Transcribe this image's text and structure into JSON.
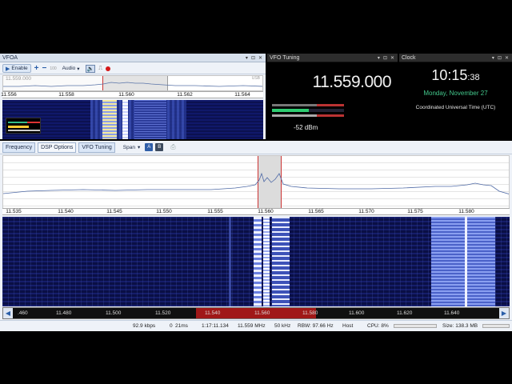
{
  "vfoa": {
    "title": "VFOA",
    "enable_label": "Enable",
    "audio_label": "Audio",
    "mini_freq": "11.559.000",
    "mini_unit": "USB",
    "scale": [
      "11.556",
      "11.558",
      "11.560",
      "11.562",
      "11.564"
    ]
  },
  "vfo_tuning": {
    "title": "VFO Tuning",
    "frequency": "11.559.000",
    "signal": "-52 dBm"
  },
  "clock": {
    "title": "Clock",
    "time_main": "10:15",
    "time_sec": ":38",
    "date": "Monday, November 27",
    "zone": "Coordinated Universal Time (UTC)"
  },
  "main": {
    "tabs": [
      "Frequency",
      "DSP Options",
      "VFO Tuning"
    ],
    "span_label": "Span",
    "btn_a": "A",
    "btn_b": "B",
    "scale": [
      "11.535",
      "11.540",
      "11.545",
      "11.550",
      "11.555",
      "11.560",
      "11.565",
      "11.570",
      "11.575",
      "11.580"
    ],
    "overview_scale": [
      ".460",
      "11.480",
      "11.500",
      "11.520",
      "11.540",
      "11.560",
      "11.580",
      "11.600",
      "11.620",
      "11.640"
    ]
  },
  "status": {
    "rate": "92.9 kbps",
    "drops": "0",
    "latency": "21ms",
    "elapsed": "1:17:11.134",
    "freq": "11.559 MHz",
    "bw": "50 kHz",
    "rbw": "RBW: 97.66 Hz",
    "host": "Host",
    "cpu": "CPU: 8%",
    "size": "Size: 138.3 MB"
  }
}
